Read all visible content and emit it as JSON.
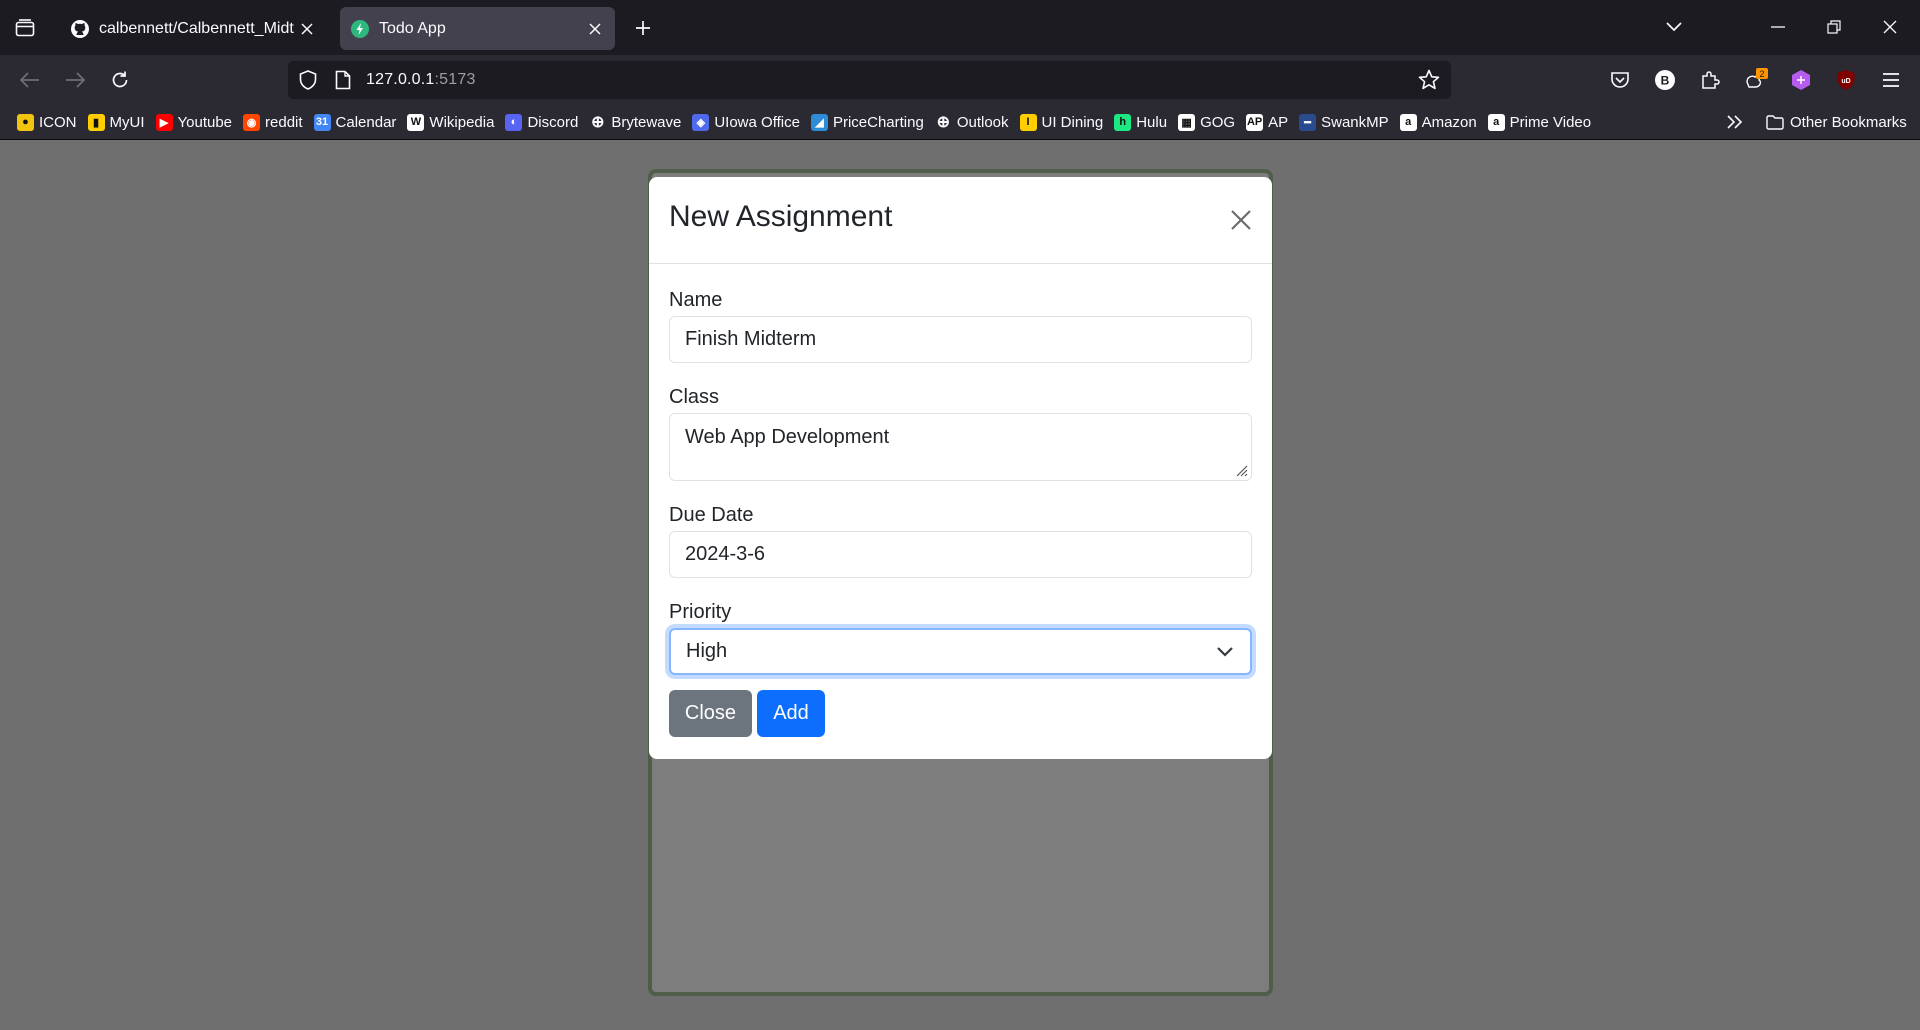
{
  "browser": {
    "tabs": [
      {
        "title": "calbennett/Calbennett_Midterm",
        "favicon": "github-icon",
        "active": false
      },
      {
        "title": "Todo App",
        "favicon": "vite-bolt-icon",
        "active": true
      }
    ],
    "url": {
      "host": "127.0.0.1",
      "port": ":5173"
    },
    "bookmarks": [
      {
        "label": "ICON",
        "icon": "icon-logo",
        "color": "#f1c40f"
      },
      {
        "label": "MyUI",
        "icon": "myui-logo",
        "color": "#ffcd00"
      },
      {
        "label": "Youtube",
        "icon": "youtube-icon",
        "color": "#ff0000"
      },
      {
        "label": "reddit",
        "icon": "reddit-icon",
        "color": "#ff4500"
      },
      {
        "label": "Calendar",
        "icon": "calendar-icon",
        "color": "#4285f4"
      },
      {
        "label": "Wikipedia",
        "icon": "wikipedia-icon",
        "color": "#ffffff"
      },
      {
        "label": "Discord",
        "icon": "discord-icon",
        "color": "#5865f2"
      },
      {
        "label": "Brytewave",
        "icon": "globe-icon",
        "color": "#fbfbfe"
      },
      {
        "label": "UIowa Office",
        "icon": "office-icon",
        "color": "#4f6bed"
      },
      {
        "label": "PriceCharting",
        "icon": "pricecharting-icon",
        "color": "#2e8bd6"
      },
      {
        "label": "Outlook",
        "icon": "globe-icon",
        "color": "#fbfbfe"
      },
      {
        "label": "UI Dining",
        "icon": "uidining-icon",
        "color": "#ffcd00"
      },
      {
        "label": "Hulu",
        "icon": "hulu-icon",
        "color": "#1ce783"
      },
      {
        "label": "GOG",
        "icon": "gog-icon",
        "color": "#ffffff"
      },
      {
        "label": "AP",
        "icon": "ap-icon",
        "color": "#ffffff"
      },
      {
        "label": "SwankMP",
        "icon": "swank-icon",
        "color": "#2a4b8d"
      },
      {
        "label": "Amazon",
        "icon": "amazon-icon",
        "color": "#ffffff"
      },
      {
        "label": "Prime Video",
        "icon": "amazon-icon",
        "color": "#ffffff"
      }
    ],
    "other_bookmarks": "Other Bookmarks"
  },
  "modal": {
    "title": "New Assignment",
    "fields": {
      "name": {
        "label": "Name",
        "value": "Finish Midterm"
      },
      "class": {
        "label": "Class",
        "value": "Web App Development"
      },
      "due_date": {
        "label": "Due Date",
        "value": "2024-3-6"
      },
      "priority": {
        "label": "Priority",
        "value": "High"
      }
    },
    "buttons": {
      "close": "Close",
      "add": "Add"
    }
  },
  "colors": {
    "primary": "#0d6efd",
    "secondary": "#6c757d",
    "card_border": "#4f5e48"
  }
}
